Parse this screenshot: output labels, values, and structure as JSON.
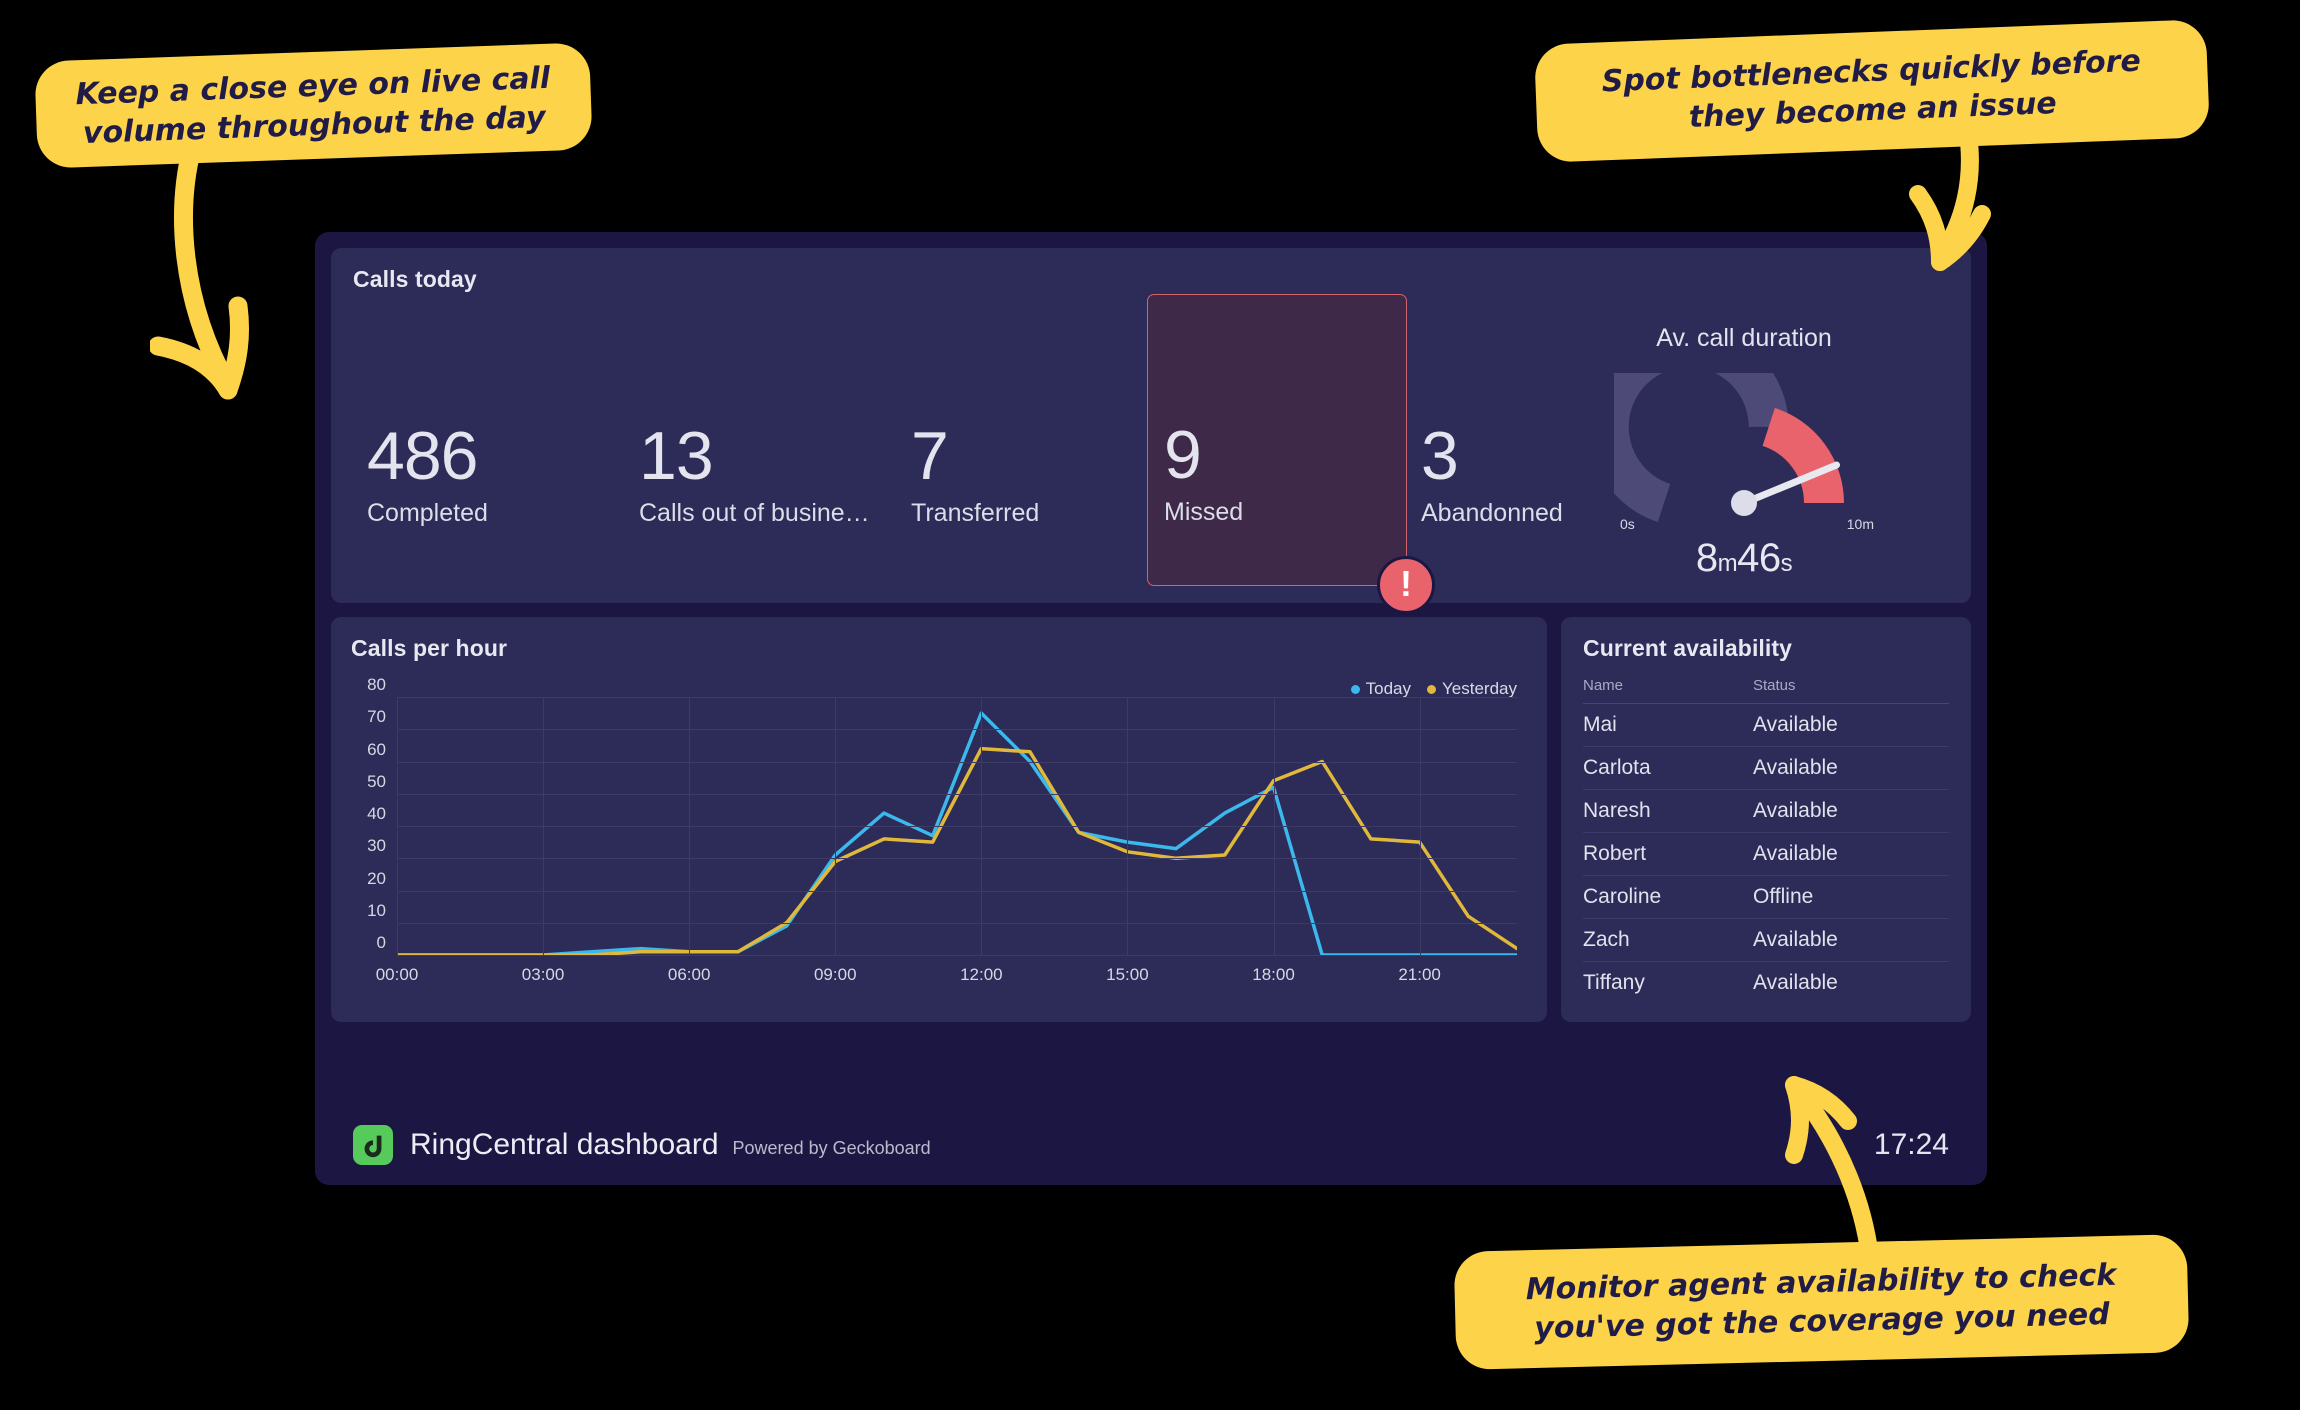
{
  "callouts": [
    {
      "id": "top-left",
      "text": "Keep a close eye on live call volume throughout the day"
    },
    {
      "id": "top-right",
      "text": "Spot bottlenecks quickly before they become an issue"
    },
    {
      "id": "bottom-right",
      "text": "Monitor agent availability to check you've got the coverage you need"
    }
  ],
  "kpi_panel": {
    "title": "Calls today",
    "metrics": [
      {
        "value": "486",
        "label": "Completed",
        "alert": false
      },
      {
        "value": "13",
        "label": "Calls out of busine…",
        "alert": false
      },
      {
        "value": "7",
        "label": "Transferred",
        "alert": false
      },
      {
        "value": "9",
        "label": "Missed",
        "alert": true
      },
      {
        "value": "3",
        "label": "Abandonned",
        "alert": false
      }
    ],
    "alert_badge_glyph": "!"
  },
  "gauge": {
    "title": "Av. call duration",
    "min_label": "0s",
    "max_label": "10m",
    "value_minutes": "8",
    "value_minutes_unit": "m",
    "value_seconds": "46",
    "value_seconds_unit": "s",
    "percent": 87.6,
    "threshold_percent": 60,
    "track_color": "#4d4a78",
    "alert_color": "#e8636c",
    "needle_color": "#e7e8f0"
  },
  "chart_panel": {
    "title": "Calls per hour"
  },
  "availability_panel": {
    "title": "Current availability",
    "columns": [
      "Name",
      "Status"
    ],
    "rows": [
      {
        "name": "Mai",
        "status": "Available"
      },
      {
        "name": "Carlota",
        "status": "Available"
      },
      {
        "name": "Naresh",
        "status": "Available"
      },
      {
        "name": "Robert",
        "status": "Available"
      },
      {
        "name": "Caroline",
        "status": "Offline"
      },
      {
        "name": "Zach",
        "status": "Available"
      },
      {
        "name": "Tiffany",
        "status": "Available"
      }
    ]
  },
  "footer": {
    "title": "RingCentral dashboard",
    "powered_by": "Powered by Geckoboard",
    "time": "17:24",
    "logo_color": "#56cb5b"
  },
  "chart_data": {
    "type": "line",
    "title": "Calls per hour",
    "xlabel": "",
    "ylabel": "",
    "ylim": [
      0,
      80
    ],
    "yticks": [
      0,
      10,
      20,
      30,
      40,
      50,
      60,
      70,
      80
    ],
    "grid": true,
    "legend_position": "top-right",
    "x": [
      "00:00",
      "01:00",
      "02:00",
      "03:00",
      "04:00",
      "05:00",
      "06:00",
      "07:00",
      "08:00",
      "09:00",
      "10:00",
      "11:00",
      "12:00",
      "13:00",
      "14:00",
      "15:00",
      "16:00",
      "17:00",
      "18:00",
      "19:00",
      "20:00",
      "21:00",
      "22:00",
      "23:00"
    ],
    "xticks": [
      "00:00",
      "03:00",
      "06:00",
      "09:00",
      "12:00",
      "15:00",
      "18:00",
      "21:00"
    ],
    "xtick_indices": [
      0,
      3,
      6,
      9,
      12,
      15,
      18,
      21
    ],
    "series": [
      {
        "name": "Today",
        "color": "#3bb8ec",
        "values": [
          0,
          0,
          0,
          0,
          1,
          2,
          1,
          1,
          9,
          31,
          44,
          37,
          75,
          60,
          38,
          35,
          33,
          44,
          52,
          0,
          0,
          0,
          0,
          0
        ]
      },
      {
        "name": "Yesterday",
        "color": "#e0b83c",
        "values": [
          0,
          0,
          0,
          0,
          0,
          1,
          1,
          1,
          10,
          29,
          36,
          35,
          64,
          63,
          38,
          32,
          30,
          31,
          54,
          60,
          36,
          35,
          12,
          2
        ]
      }
    ]
  }
}
